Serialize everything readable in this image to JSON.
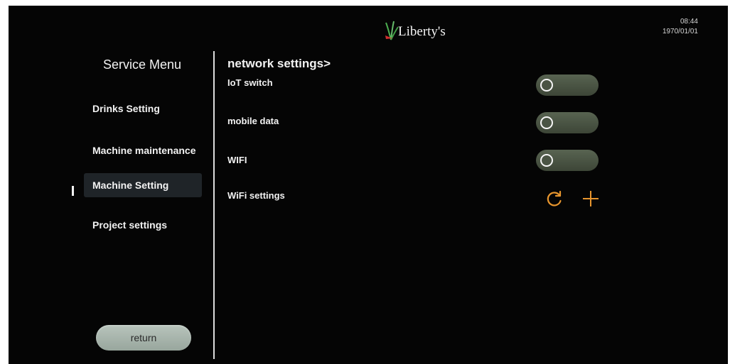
{
  "header": {
    "brand": "Liberty's",
    "time": "08:44",
    "date": "1970/01/01"
  },
  "sidebar": {
    "title": "Service Menu",
    "items": [
      {
        "label": "Drinks Setting",
        "active": false
      },
      {
        "label": "Machine maintenance",
        "active": false
      },
      {
        "label": "Machine Setting",
        "active": true
      },
      {
        "label": "Project settings",
        "active": false
      }
    ],
    "return_label": "return"
  },
  "main": {
    "section_title": "network settings>",
    "rows": [
      {
        "label": "IoT switch",
        "control": "toggle",
        "state": "off"
      },
      {
        "label": "mobile data",
        "control": "toggle",
        "state": "off"
      },
      {
        "label": "WIFI",
        "control": "toggle",
        "state": "off"
      },
      {
        "label": "WiFi settings",
        "control": "icons",
        "icons": [
          "refresh-icon",
          "plus-icon"
        ]
      }
    ]
  },
  "colors": {
    "background": "#050505",
    "text": "#f2f2f2",
    "accent_orange": "#e8962e",
    "toggle_off": "#4a5444",
    "return_button": "#a8b5ac",
    "active_item": "#1f2428"
  }
}
